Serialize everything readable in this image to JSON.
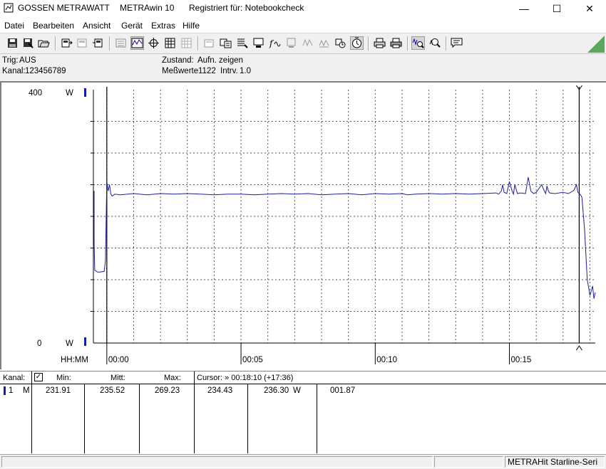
{
  "window": {
    "vendor": "GOSSEN METRAWATT",
    "app_name": "METRAwin 10",
    "registered": "Registriert für: Notebookcheck",
    "minimize_glyph": "—",
    "maximize_glyph": "☐",
    "close_glyph": "✕"
  },
  "menu": [
    "Datei",
    "Bearbeiten",
    "Ansicht",
    "Gerät",
    "Extras",
    "Hilfe"
  ],
  "toolbar": {
    "icons": [
      "save-icon",
      "save-as-icon",
      "open-folder-icon",
      "device-read-icon",
      "device-config-icon",
      "device-send-icon",
      "list-view-icon",
      "waveform-view-icon",
      "crosshair-icon",
      "table-view-icon",
      "table-grid-icon",
      "chart-export-icon",
      "data-transfer-icon",
      "list-settings-icon",
      "monitor-icon",
      "function-icon",
      "device-icon",
      "signal-icon",
      "signal-grid-icon",
      "magnet-icon",
      "compass-icon",
      "print-preview-icon",
      "print-icon",
      "zoom-waveform-icon",
      "zoom-icon",
      "comment-icon"
    ],
    "accent_color": "#5aa85a"
  },
  "info": {
    "trig_label": "Trig:",
    "trig_value": "AUS",
    "kanal_label": "Kanal:",
    "kanal_value": "123456789",
    "zustand_label": "Zustand:",
    "zustand_value": "Aufn. zeigen",
    "messwerte_label": "Meßwerte",
    "messwerte_value": "1122",
    "intrv_label": "Intrv.",
    "intrv_value": "1.0"
  },
  "chart_data": {
    "type": "line",
    "ylim": [
      0,
      400
    ],
    "y_top_label": "400",
    "y_bottom_label": "0",
    "y_unit": "W",
    "x_axis_label": "HH:MM",
    "x_ticks": [
      "00:00",
      "00:05",
      "00:10",
      "00:15"
    ],
    "x_tick_minutes": [
      0,
      5,
      10,
      15
    ],
    "x_range_minutes": [
      -0.5,
      18.2
    ],
    "cursor_minutes": 17.6,
    "start_minutes": 0,
    "series": [
      {
        "color": "#1f1f9a",
        "x_minutes": [
          -0.55,
          -0.5,
          -0.45,
          -0.35,
          -0.25,
          -0.1,
          -0.05,
          0,
          0.05,
          0.1,
          0.15,
          0.2,
          0.3,
          0.5,
          1,
          1.5,
          2,
          2.5,
          3,
          3.5,
          4,
          4.5,
          5,
          5.5,
          6,
          6.5,
          7,
          7.5,
          8,
          8.5,
          9,
          9.5,
          10,
          10.5,
          11,
          11.2,
          11.5,
          12,
          12.5,
          13,
          13.5,
          14,
          14.5,
          14.6,
          14.7,
          14.75,
          14.8,
          14.9,
          15,
          15.1,
          15.15,
          15.2,
          15.3,
          15.4,
          15.6,
          15.7,
          15.8,
          15.9,
          16,
          16.2,
          16.3,
          16.35,
          16.4,
          16.45,
          16.5,
          16.7,
          17,
          17.2,
          17.4,
          17.5,
          17.55,
          17.6,
          17.65,
          17.7,
          17.8,
          17.9,
          18.0,
          18.1,
          18.15,
          18.2
        ],
        "y_watts": [
          240,
          160,
          115,
          112,
          112,
          113,
          130,
          255,
          240,
          250,
          235,
          232,
          235,
          234,
          236,
          234,
          236,
          235,
          236,
          235,
          234,
          235,
          235,
          234,
          235,
          236,
          235,
          236,
          234,
          235,
          236,
          234,
          236,
          235,
          236,
          234,
          235,
          236,
          235,
          236,
          235,
          236,
          237,
          235,
          240,
          250,
          238,
          236,
          255,
          240,
          235,
          250,
          236,
          237,
          236,
          262,
          240,
          236,
          238,
          250,
          240,
          236,
          248,
          240,
          237,
          236,
          238,
          236,
          241,
          250,
          238,
          236,
          234,
          230,
          180,
          100,
          75,
          90,
          70,
          80
        ]
      }
    ]
  },
  "table": {
    "headers": {
      "kanal": "Kanal:",
      "min": "Min:",
      "mitt": "Mitt:",
      "max": "Max:",
      "cursor": "Cursor: » 00:18:10 (+17:36)"
    },
    "row": {
      "channel": "1",
      "unit": "M",
      "min": "231.91",
      "mitt": "235.52",
      "max": "269.23",
      "cursor_value": "234.43",
      "value2": "236.30",
      "value2_unit": "W",
      "value3": "001.87"
    }
  },
  "status": {
    "device": "METRAHit Starline-Seri"
  }
}
